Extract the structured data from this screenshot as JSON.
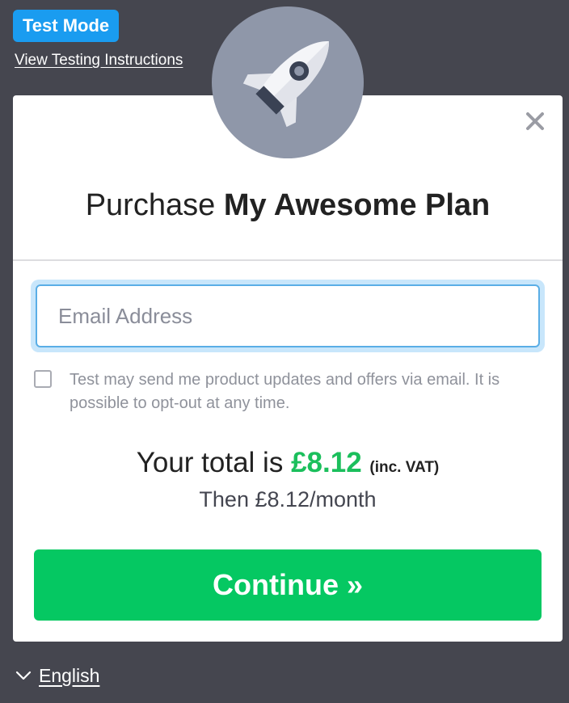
{
  "test_mode": {
    "badge_label": "Test Mode",
    "instructions_link": "View Testing Instructions"
  },
  "logo": {
    "icon": "rocket-icon"
  },
  "modal": {
    "close_icon": "close-icon",
    "title_prefix": "Purchase",
    "title_plan": "My Awesome Plan",
    "email_placeholder": "Email Address",
    "email_value": "",
    "optin_checked": false,
    "optin_text": "Test may send me product updates and offers via email. It is possible to opt-out at any time.",
    "total_prefix": "Your total is",
    "total_price": "£8.12",
    "total_vat": "(inc. VAT)",
    "recurring": "Then £8.12/month",
    "continue_label": "Continue »"
  },
  "footer": {
    "language": "English"
  },
  "colors": {
    "background": "#45464f",
    "badge": "#1a9cf0",
    "accent_green": "#05c862",
    "price_green": "#1bbf5c",
    "logo_circle": "#8f97a9"
  }
}
